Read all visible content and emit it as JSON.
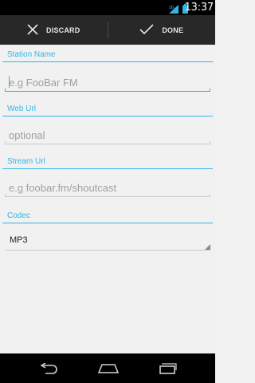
{
  "status_bar": {
    "time": "13:37",
    "icons": [
      "signal-3g-icon",
      "battery-icon"
    ]
  },
  "action_bar": {
    "discard_label": "DISCARD",
    "done_label": "DONE"
  },
  "form": {
    "station_name": {
      "label": "Station Name",
      "placeholder": "e.g FooBar FM"
    },
    "web_url": {
      "label": "Web Url",
      "placeholder": "optional"
    },
    "stream_url": {
      "label": "Stream Url",
      "placeholder": "e.g foobar.fm/shoutcast"
    },
    "codec": {
      "label": "Codec",
      "value": "MP3"
    }
  },
  "nav_bar": {
    "icons": [
      "back-icon",
      "home-icon",
      "recent-apps-icon"
    ]
  },
  "colors": {
    "accent": "#33b5e5",
    "action_bar": "#282828",
    "background": "#f1f1f1"
  }
}
